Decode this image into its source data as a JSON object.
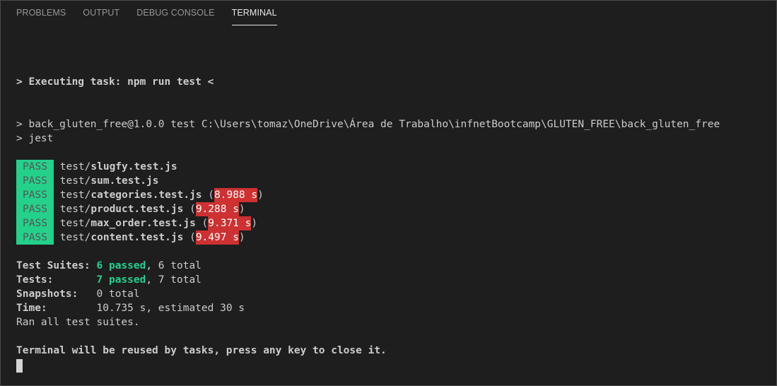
{
  "tabs": [
    "PROBLEMS",
    "OUTPUT",
    "DEBUG CONSOLE",
    "TERMINAL"
  ],
  "terminal": {
    "executing": "> Executing task: npm run test <",
    "cmd_line": "> back_gluten_free@1.0.0 test C:\\Users\\tomaz\\OneDrive\\Área de Trabalho\\infnetBootcamp\\GLUTEN_FREE\\back_gluten_free",
    "jest_line": "> jest",
    "pass_label": "PASS",
    "results": [
      {
        "dir": "test/",
        "file": "slugfy.test.js",
        "duration": ""
      },
      {
        "dir": "test/",
        "file": "sum.test.js",
        "duration": ""
      },
      {
        "dir": "test/",
        "file": "categories.test.js",
        "duration": "8.988 s"
      },
      {
        "dir": "test/",
        "file": "product.test.js",
        "duration": "9.288 s"
      },
      {
        "dir": "test/",
        "file": "max_order.test.js",
        "duration": "9.371 s"
      },
      {
        "dir": "test/",
        "file": "content.test.js",
        "duration": "9.497 s"
      }
    ],
    "summary": {
      "suites_label": "Test Suites: ",
      "suites_passed": "6 passed",
      "suites_rest": ", 6 total",
      "tests_label": "Tests:       ",
      "tests_passed": "7 passed",
      "tests_rest": ", 7 total",
      "snapshots_label": "Snapshots:   ",
      "snapshots_value": "0 total",
      "time_label": "Time:        ",
      "time_value": "10.735 s, estimated 30 s",
      "ran_all": "Ran all test suites."
    },
    "reuse_msg": "Terminal will be reused by tasks, press any key to close it."
  },
  "colors": {
    "background": "#1e1e1e",
    "pass_bg": "#23d18b",
    "duration_bg": "#cd3131",
    "passed_text": "#23d18b"
  }
}
